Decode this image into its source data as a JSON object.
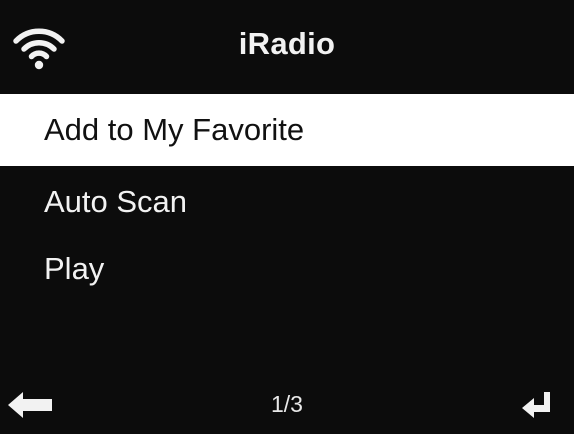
{
  "header": {
    "title": "iRadio",
    "status_icon": "wifi-icon"
  },
  "menu": {
    "items": [
      {
        "label": "Add to My Favorite",
        "selected": true
      },
      {
        "label": "Auto Scan",
        "selected": false
      },
      {
        "label": "Play",
        "selected": false
      }
    ]
  },
  "footer": {
    "back_icon": "back-arrow-icon",
    "page_indicator": "1/3",
    "enter_icon": "enter-icon"
  },
  "colors": {
    "background": "#0c0c0c",
    "text": "#f2f2f2",
    "selected_background": "#ffffff",
    "selected_text": "#111111"
  }
}
